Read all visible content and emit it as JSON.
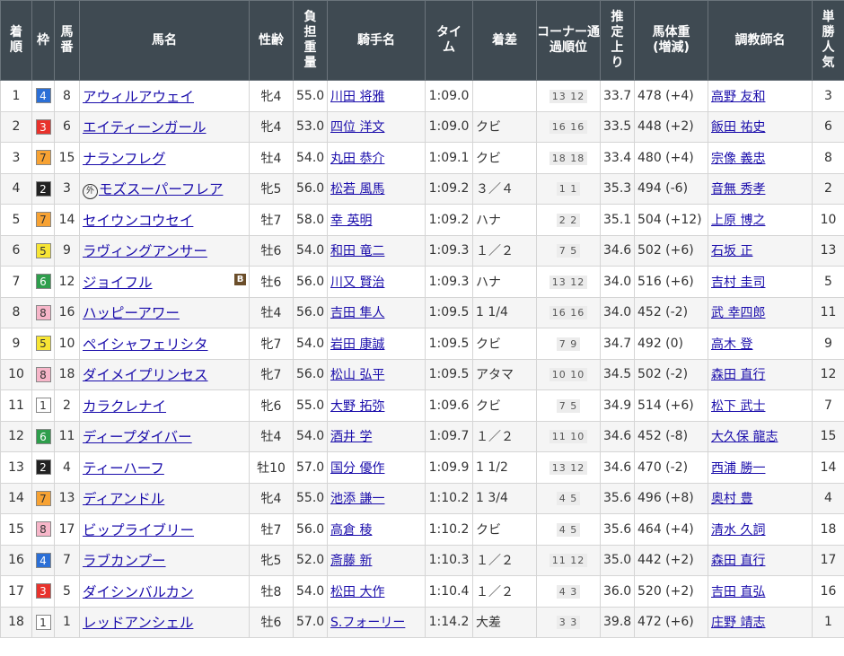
{
  "headers": {
    "rank": "着順",
    "waku": "枠",
    "umaban": "馬番",
    "horse": "馬名",
    "sexage": "性齢",
    "weight": "負担重量",
    "jockey": "騎手名",
    "time": "タイム",
    "margin": "着差",
    "corner": "コーナー通過順位",
    "agari": "推定上り",
    "body": "馬体重(増減)",
    "trainer": "調教師名",
    "pop": "単勝人気"
  },
  "waku_colors": {
    "1": {
      "bg": "#ffffff",
      "fg": "#333333"
    },
    "2": {
      "bg": "#222222",
      "fg": "#ffffff"
    },
    "3": {
      "bg": "#e8322c",
      "fg": "#ffffff"
    },
    "4": {
      "bg": "#2b6fd6",
      "fg": "#ffffff"
    },
    "5": {
      "bg": "#f7e534",
      "fg": "#333333"
    },
    "6": {
      "bg": "#2e9e4c",
      "fg": "#ffffff"
    },
    "7": {
      "bg": "#f7a233",
      "fg": "#333333"
    },
    "8": {
      "bg": "#f7b6c9",
      "fg": "#333333"
    }
  },
  "rows": [
    {
      "rank": "1",
      "waku": "4",
      "umaban": "8",
      "horse": "アウィルアウェイ",
      "gai": "",
      "blinker": "",
      "sexage": "牝4",
      "weight": "55.0",
      "jockey": "川田 将雅",
      "time": "1:09.0",
      "margin": "",
      "corner": "13 12",
      "agari": "33.7",
      "body": "478 (+4)",
      "trainer": "高野 友和",
      "pop": "3"
    },
    {
      "rank": "2",
      "waku": "3",
      "umaban": "6",
      "horse": "エイティーンガール",
      "gai": "",
      "blinker": "",
      "sexage": "牝4",
      "weight": "53.0",
      "jockey": "四位 洋文",
      "time": "1:09.0",
      "margin": "クビ",
      "corner": "16 16",
      "agari": "33.5",
      "body": "448 (+2)",
      "trainer": "飯田 祐史",
      "pop": "6"
    },
    {
      "rank": "3",
      "waku": "7",
      "umaban": "15",
      "horse": "ナランフレグ",
      "gai": "",
      "blinker": "",
      "sexage": "牡4",
      "weight": "54.0",
      "jockey": "丸田 恭介",
      "time": "1:09.1",
      "margin": "クビ",
      "corner": "18 18",
      "agari": "33.4",
      "body": "480 (+4)",
      "trainer": "宗像 義忠",
      "pop": "8"
    },
    {
      "rank": "4",
      "waku": "2",
      "umaban": "3",
      "horse": "モズスーパーフレア",
      "gai": "外",
      "blinker": "",
      "sexage": "牝5",
      "weight": "56.0",
      "jockey": "松若 風馬",
      "time": "1:09.2",
      "margin": "３／４",
      "corner": "1 1",
      "agari": "35.3",
      "body": "494 (-6)",
      "trainer": "音無 秀孝",
      "pop": "2"
    },
    {
      "rank": "5",
      "waku": "7",
      "umaban": "14",
      "horse": "セイウンコウセイ",
      "gai": "",
      "blinker": "",
      "sexage": "牡7",
      "weight": "58.0",
      "jockey": "幸 英明",
      "time": "1:09.2",
      "margin": "ハナ",
      "corner": "2 2",
      "agari": "35.1",
      "body": "504 (+12)",
      "trainer": "上原 博之",
      "pop": "10"
    },
    {
      "rank": "6",
      "waku": "5",
      "umaban": "9",
      "horse": "ラヴィングアンサー",
      "gai": "",
      "blinker": "",
      "sexage": "牡6",
      "weight": "54.0",
      "jockey": "和田 竜二",
      "time": "1:09.3",
      "margin": "１／２",
      "corner": "7 5",
      "agari": "34.6",
      "body": "502 (+6)",
      "trainer": "石坂 正",
      "pop": "13"
    },
    {
      "rank": "7",
      "waku": "6",
      "umaban": "12",
      "horse": "ジョイフル",
      "gai": "",
      "blinker": "B",
      "sexage": "牡6",
      "weight": "56.0",
      "jockey": "川又 賢治",
      "time": "1:09.3",
      "margin": "ハナ",
      "corner": "13 12",
      "agari": "34.0",
      "body": "516 (+6)",
      "trainer": "吉村 圭司",
      "pop": "5"
    },
    {
      "rank": "8",
      "waku": "8",
      "umaban": "16",
      "horse": "ハッピーアワー",
      "gai": "",
      "blinker": "",
      "sexage": "牡4",
      "weight": "56.0",
      "jockey": "吉田 隼人",
      "time": "1:09.5",
      "margin": "1 1/4",
      "corner": "16 16",
      "agari": "34.0",
      "body": "452 (-2)",
      "trainer": "武 幸四郎",
      "pop": "11"
    },
    {
      "rank": "9",
      "waku": "5",
      "umaban": "10",
      "horse": "ペイシャフェリシタ",
      "gai": "",
      "blinker": "",
      "sexage": "牝7",
      "weight": "54.0",
      "jockey": "岩田 康誠",
      "time": "1:09.5",
      "margin": "クビ",
      "corner": "7 9",
      "agari": "34.7",
      "body": "492 (0)",
      "trainer": "高木 登",
      "pop": "9"
    },
    {
      "rank": "10",
      "waku": "8",
      "umaban": "18",
      "horse": "ダイメイプリンセス",
      "gai": "",
      "blinker": "",
      "sexage": "牝7",
      "weight": "56.0",
      "jockey": "松山 弘平",
      "time": "1:09.5",
      "margin": "アタマ",
      "corner": "10 10",
      "agari": "34.5",
      "body": "502 (-2)",
      "trainer": "森田 直行",
      "pop": "12"
    },
    {
      "rank": "11",
      "waku": "1",
      "umaban": "2",
      "horse": "カラクレナイ",
      "gai": "",
      "blinker": "",
      "sexage": "牝6",
      "weight": "55.0",
      "jockey": "大野 拓弥",
      "time": "1:09.6",
      "margin": "クビ",
      "corner": "7 5",
      "agari": "34.9",
      "body": "514 (+6)",
      "trainer": "松下 武士",
      "pop": "7"
    },
    {
      "rank": "12",
      "waku": "6",
      "umaban": "11",
      "horse": "ディープダイバー",
      "gai": "",
      "blinker": "",
      "sexage": "牡4",
      "weight": "54.0",
      "jockey": "酒井 学",
      "time": "1:09.7",
      "margin": "１／２",
      "corner": "11 10",
      "agari": "34.6",
      "body": "452 (-8)",
      "trainer": "大久保 龍志",
      "pop": "15"
    },
    {
      "rank": "13",
      "waku": "2",
      "umaban": "4",
      "horse": "ティーハーフ",
      "gai": "",
      "blinker": "",
      "sexage": "牡10",
      "weight": "57.0",
      "jockey": "国分 優作",
      "time": "1:09.9",
      "margin": "1 1/2",
      "corner": "13 12",
      "agari": "34.6",
      "body": "470 (-2)",
      "trainer": "西浦 勝一",
      "pop": "14"
    },
    {
      "rank": "14",
      "waku": "7",
      "umaban": "13",
      "horse": "ディアンドル",
      "gai": "",
      "blinker": "",
      "sexage": "牝4",
      "weight": "55.0",
      "jockey": "池添 謙一",
      "time": "1:10.2",
      "margin": "1 3/4",
      "corner": "4 5",
      "agari": "35.6",
      "body": "496 (+8)",
      "trainer": "奥村 豊",
      "pop": "4"
    },
    {
      "rank": "15",
      "waku": "8",
      "umaban": "17",
      "horse": "ビップライブリー",
      "gai": "",
      "blinker": "",
      "sexage": "牡7",
      "weight": "56.0",
      "jockey": "高倉 稜",
      "time": "1:10.2",
      "margin": "クビ",
      "corner": "4 5",
      "agari": "35.6",
      "body": "464 (+4)",
      "trainer": "清水 久詞",
      "pop": "18"
    },
    {
      "rank": "16",
      "waku": "4",
      "umaban": "7",
      "horse": "ラブカンプー",
      "gai": "",
      "blinker": "",
      "sexage": "牝5",
      "weight": "52.0",
      "jockey": "斎藤 新",
      "time": "1:10.3",
      "margin": "１／２",
      "corner": "11 12",
      "agari": "35.0",
      "body": "442 (+2)",
      "trainer": "森田 直行",
      "pop": "17"
    },
    {
      "rank": "17",
      "waku": "3",
      "umaban": "5",
      "horse": "ダイシンバルカン",
      "gai": "",
      "blinker": "",
      "sexage": "牡8",
      "weight": "54.0",
      "jockey": "松田 大作",
      "time": "1:10.4",
      "margin": "１／２",
      "corner": "4 3",
      "agari": "36.0",
      "body": "520 (+2)",
      "trainer": "吉田 直弘",
      "pop": "16"
    },
    {
      "rank": "18",
      "waku": "1",
      "umaban": "1",
      "horse": "レッドアンシェル",
      "gai": "",
      "blinker": "",
      "sexage": "牡6",
      "weight": "57.0",
      "jockey": "S.フォーリー",
      "time": "1:14.2",
      "margin": "大差",
      "corner": "3 3",
      "agari": "39.8",
      "body": "472 (+6)",
      "trainer": "庄野 靖志",
      "pop": "1"
    }
  ]
}
